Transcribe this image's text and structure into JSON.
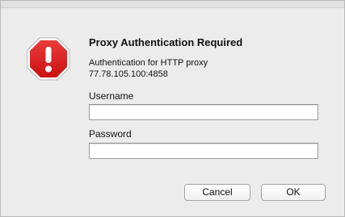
{
  "dialog": {
    "title": "Proxy Authentication Required",
    "message_line1": "Authentication for HTTP proxy",
    "message_line2": "77.78.105.100:4858",
    "icon": "stop-alert-icon",
    "icon_color": "#d21b1b"
  },
  "form": {
    "username_label": "Username",
    "username_value": "",
    "password_label": "Password",
    "password_value": ""
  },
  "buttons": {
    "cancel_label": "Cancel",
    "ok_label": "OK"
  }
}
